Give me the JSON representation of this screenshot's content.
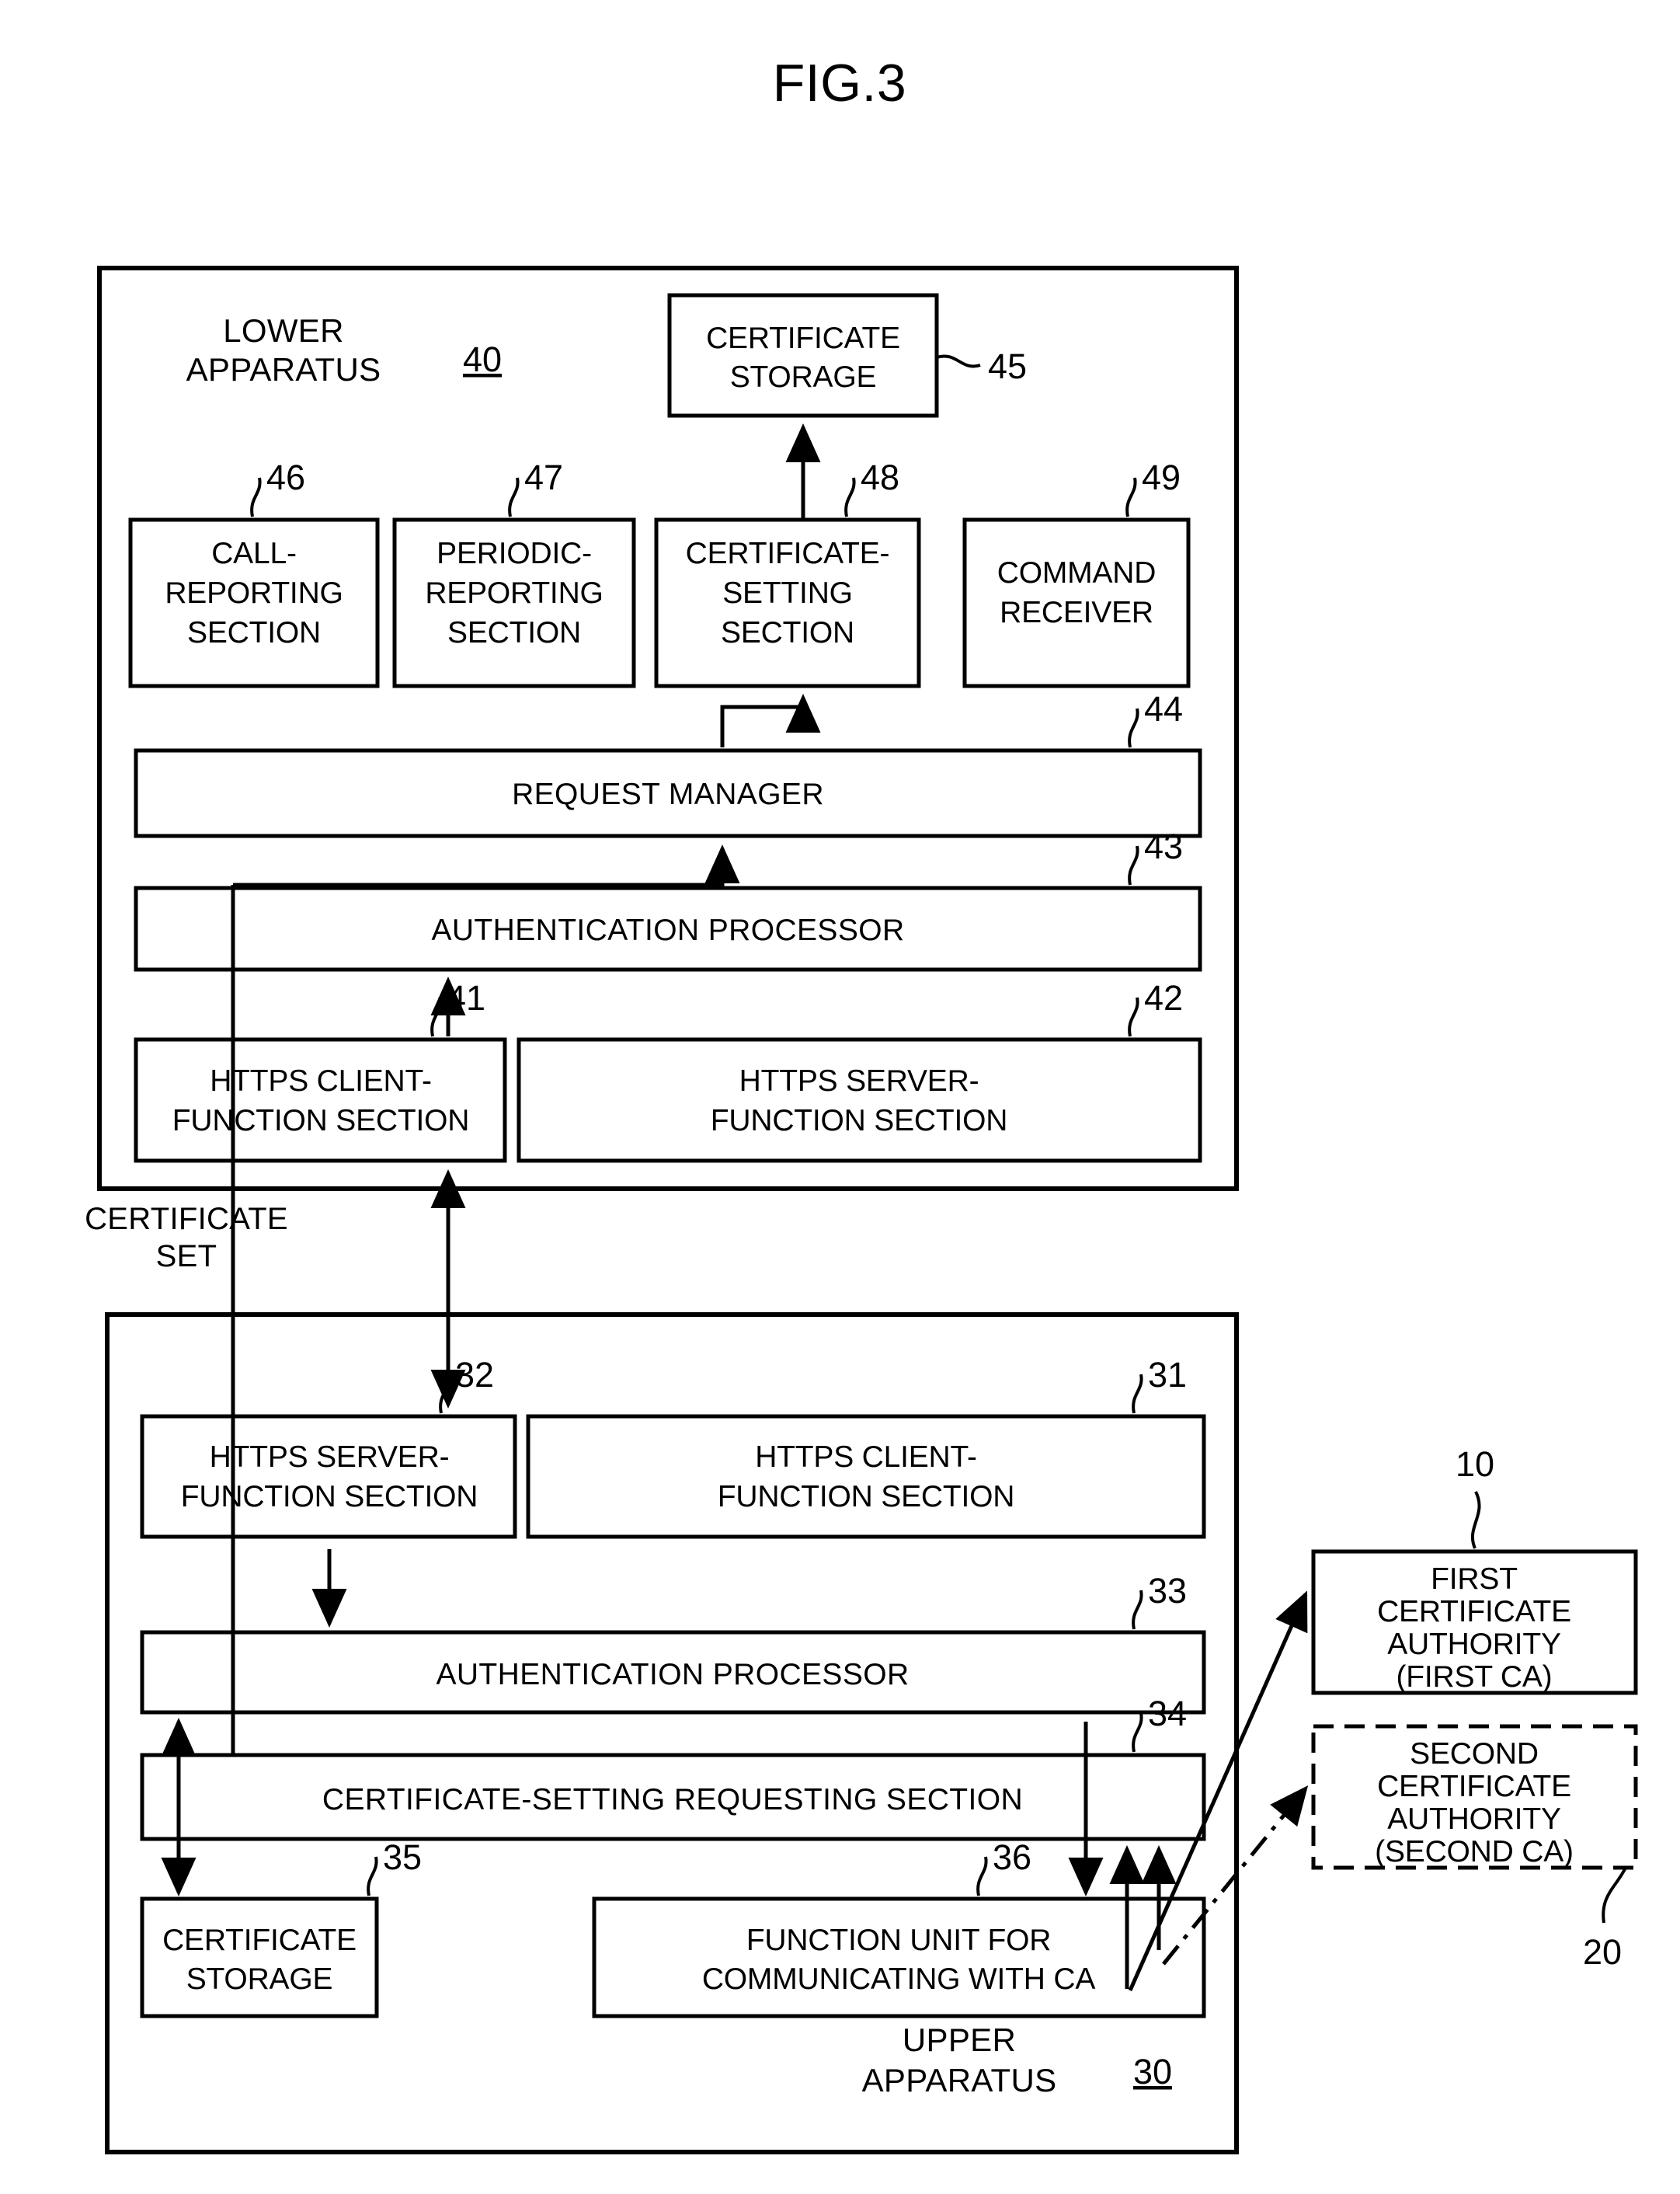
{
  "figure": {
    "title": "FIG.3"
  },
  "free_labels": {
    "certificate_set": {
      "line1": "CERTIFICATE",
      "line2": "SET"
    }
  },
  "lower_apparatus": {
    "name_line1": "LOWER",
    "name_line2": "APPARATUS",
    "ref": "40",
    "blocks": [
      {
        "id": "certificate-storage-45",
        "ref": "45",
        "lines": [
          "CERTIFICATE",
          "STORAGE"
        ]
      },
      {
        "id": "call-reporting-section-46",
        "ref": "46",
        "lines": [
          "CALL-",
          "REPORTING",
          "SECTION"
        ]
      },
      {
        "id": "periodic-reporting-section-47",
        "ref": "47",
        "lines": [
          "PERIODIC-",
          "REPORTING",
          "SECTION"
        ]
      },
      {
        "id": "certificate-setting-section-48",
        "ref": "48",
        "lines": [
          "CERTIFICATE-",
          "SETTING",
          "SECTION"
        ]
      },
      {
        "id": "command-receiver-49",
        "ref": "49",
        "lines": [
          "COMMAND",
          "RECEIVER"
        ]
      },
      {
        "id": "request-manager-44",
        "ref": "44",
        "lines": [
          "REQUEST MANAGER"
        ]
      },
      {
        "id": "authentication-processor-43",
        "ref": "43",
        "lines": [
          "AUTHENTICATION PROCESSOR"
        ]
      },
      {
        "id": "https-client-function-section-41",
        "ref": "41",
        "lines": [
          "HTTPS CLIENT-",
          "FUNCTION SECTION"
        ]
      },
      {
        "id": "https-server-function-section-42",
        "ref": "42",
        "lines": [
          "HTTPS SERVER-",
          "FUNCTION SECTION"
        ]
      }
    ]
  },
  "upper_apparatus": {
    "name_line1": "UPPER",
    "name_line2": "APPARATUS",
    "ref": "30",
    "blocks": [
      {
        "id": "https-server-function-section-32",
        "ref": "32",
        "lines": [
          "HTTPS SERVER-",
          "FUNCTION SECTION"
        ]
      },
      {
        "id": "https-client-function-section-31",
        "ref": "31",
        "lines": [
          "HTTPS CLIENT-",
          "FUNCTION SECTION"
        ]
      },
      {
        "id": "authentication-processor-33",
        "ref": "33",
        "lines": [
          "AUTHENTICATION PROCESSOR"
        ]
      },
      {
        "id": "certificate-setting-requesting-section-34",
        "ref": "34",
        "lines": [
          "CERTIFICATE-SETTING REQUESTING SECTION"
        ]
      },
      {
        "id": "certificate-storage-35",
        "ref": "35",
        "lines": [
          "CERTIFICATE",
          "STORAGE"
        ]
      },
      {
        "id": "function-unit-for-communicating-with-ca-36",
        "ref": "36",
        "lines": [
          "FUNCTION UNIT FOR",
          "COMMUNICATING WITH CA"
        ]
      }
    ]
  },
  "certificate_authorities": [
    {
      "id": "first-certificate-authority-10",
      "ref": "10",
      "lines": [
        "FIRST",
        "CERTIFICATE",
        "AUTHORITY",
        "(FIRST CA)"
      ],
      "border": "solid"
    },
    {
      "id": "second-certificate-authority-20",
      "ref": "20",
      "lines": [
        "SECOND",
        "CERTIFICATE",
        "AUTHORITY",
        "(SECOND CA)"
      ],
      "border": "dashed"
    }
  ]
}
